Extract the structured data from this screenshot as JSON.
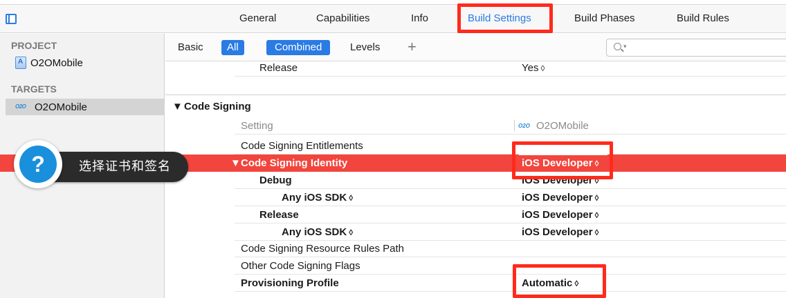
{
  "tabs": {
    "items": [
      "General",
      "Capabilities",
      "Info",
      "Build Settings",
      "Build Phases",
      "Build Rules"
    ],
    "active": "Build Settings"
  },
  "sidebar": {
    "project_header": "PROJECT",
    "project_name": "O2OMobile",
    "targets_header": "TARGETS",
    "target_name": "O2OMobile",
    "target_icon_text": "O2O"
  },
  "filterbar": {
    "basic": "Basic",
    "all": "All",
    "combined": "Combined",
    "levels": "Levels",
    "add": "+",
    "search_placeholder": ""
  },
  "settings": {
    "release_row": {
      "label": "Release",
      "value": "Yes"
    },
    "section_title": "Code Signing",
    "header_setting": "Setting",
    "header_target": "O2OMobile",
    "rows": [
      {
        "label": "Code Signing Entitlements",
        "value": ""
      },
      {
        "label": "Code Signing Identity",
        "value": "iOS Developer"
      },
      {
        "label": "Debug",
        "value": "iOS Developer"
      },
      {
        "label": "Any iOS SDK",
        "value": "iOS Developer"
      },
      {
        "label": "Release",
        "value": "iOS Developer"
      },
      {
        "label": "Any iOS SDK",
        "value": "iOS Developer"
      },
      {
        "label": "Code Signing Resource Rules Path",
        "value": ""
      },
      {
        "label": "Other Code Signing Flags",
        "value": ""
      },
      {
        "label": "Provisioning Profile",
        "value": "Automatic"
      }
    ]
  },
  "tooltip": {
    "icon": "?",
    "text": "选择证书和签名"
  },
  "colors": {
    "accent": "#2a7be4",
    "highlight_row": "#f2453d",
    "annotation_box": "#ff2a1c"
  }
}
